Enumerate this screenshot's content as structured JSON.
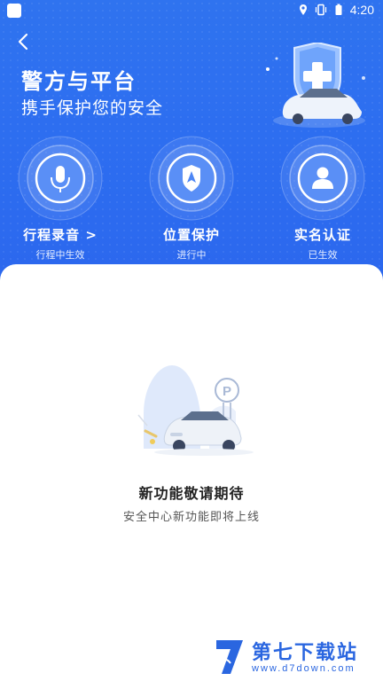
{
  "status_bar": {
    "time": "4:20",
    "icons": [
      "app-icon",
      "location-icon",
      "vibrate-icon",
      "battery-icon"
    ]
  },
  "header": {
    "back_icon": "chevron-left-icon",
    "title": "警方与平台",
    "subtitle": "携手保护您的安全"
  },
  "features": [
    {
      "icon": "microphone-icon",
      "label": "行程录音 >",
      "status": "行程中生效"
    },
    {
      "icon": "location-shield-icon",
      "label": "位置保护",
      "status": "进行中"
    },
    {
      "icon": "person-icon",
      "label": "实名认证",
      "status": "已生效"
    }
  ],
  "empty_state": {
    "illustration": "car-parking-illustration",
    "title": "新功能敬请期待",
    "subtitle": "安全中心新功能即将上线"
  },
  "watermark": {
    "text": "第七下载站",
    "url": "www.d7down.com"
  },
  "colors": {
    "hero_blue": "#2d6ef0",
    "ring_blue": "#4d86f5",
    "white": "#ffffff"
  }
}
